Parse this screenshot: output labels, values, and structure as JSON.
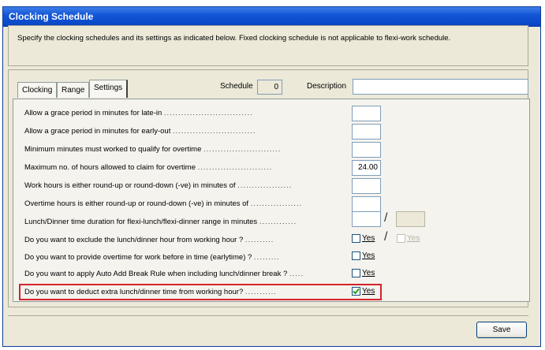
{
  "window": {
    "title": "Clocking Schedule"
  },
  "intro_text": "Specify the clocking schedules and its settings as indicated below. Fixed clocking schedule is not applicable to flexi-work schedule.",
  "tabs": [
    {
      "label": "Clocking",
      "active": false
    },
    {
      "label": "Range",
      "active": false
    },
    {
      "label": "Settings",
      "active": true
    }
  ],
  "schedule": {
    "label": "Schedule",
    "value": "0"
  },
  "description": {
    "label": "Description",
    "value": ""
  },
  "settings": [
    {
      "label": "Allow a grace period in minutes for late-in",
      "value": ""
    },
    {
      "label": "Allow a grace period in minutes for early-out",
      "value": ""
    },
    {
      "label": "Minimum minutes must worked to qualify for overtime",
      "value": ""
    },
    {
      "label": "Maximum no. of hours allowed to claim for overtime",
      "value": "24.00"
    },
    {
      "label": "Work hours is either round-up or round-down (-ve) in minutes of",
      "value": ""
    },
    {
      "label": "Overtime hours is either round-up or round-down (-ve) in minutes of",
      "value": ""
    },
    {
      "label": "Lunch/Dinner time duration for flexi-lunch/flexi-dinner range in minutes",
      "value": "",
      "value2": ""
    },
    {
      "label": "Do you want to exclude the lunch/dinner hour from working hour ?",
      "checkbox": "Yes",
      "checked": false,
      "checkbox2": "Yes",
      "checked2": false
    },
    {
      "label": "Do you want to provide overtime for work before in time (earlytime) ?",
      "checkbox": "Yes",
      "checked": false
    },
    {
      "label": "Do you want to apply Auto Add Break Rule when including lunch/dinner break ?",
      "checkbox": "Yes",
      "checked": false
    },
    {
      "label": "Do you want to deduct extra lunch/dinner time from working hour?",
      "checkbox": "Yes",
      "checked": true
    }
  ],
  "save_label": "Save",
  "colors": {
    "title_bar": "#1356d6",
    "highlight": "#d4242c",
    "window_bg": "#ece9d8"
  }
}
